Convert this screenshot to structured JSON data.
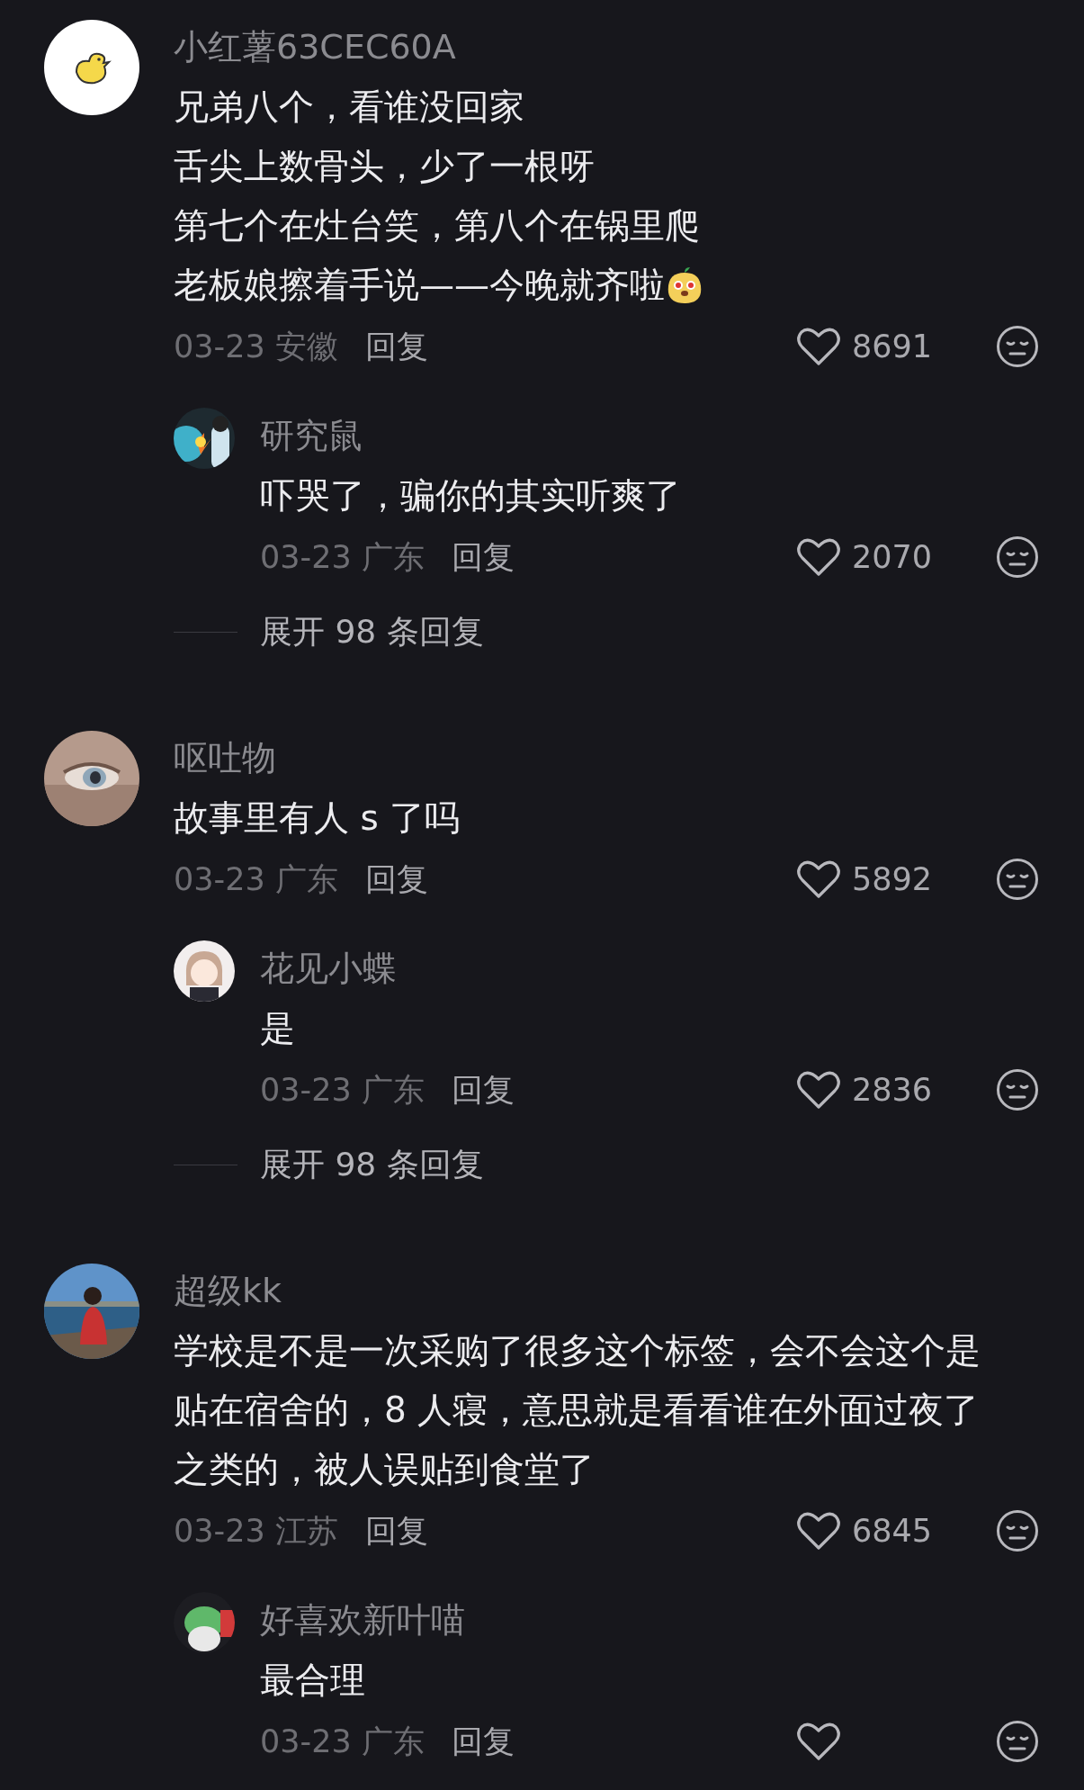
{
  "comments": [
    {
      "user": "小红薯63CEC60A",
      "lines": [
        "兄弟八个，看谁没回家",
        "舌尖上数骨头，少了一根呀",
        "第七个在灶台笑，第八个在锅里爬",
        "老板娘擦着手说——今晚就齐啦"
      ],
      "sticker": true,
      "date": "03-23 安徽",
      "reply_label": "回复",
      "likes": "8691",
      "replies": [
        {
          "user": "研究鼠",
          "lines": [
            "吓哭了，骗你的其实听爽了"
          ],
          "date": "03-23 广东",
          "reply_label": "回复",
          "likes": "2070"
        }
      ],
      "expand": "展开 98 条回复"
    },
    {
      "user": "呕吐物",
      "lines": [
        "故事里有人 s 了吗"
      ],
      "sticker": false,
      "date": "03-23 广东",
      "reply_label": "回复",
      "likes": "5892",
      "replies": [
        {
          "user": "花见小蝶",
          "lines": [
            "是"
          ],
          "date": "03-23 广东",
          "reply_label": "回复",
          "likes": "2836"
        }
      ],
      "expand": "展开 98 条回复"
    },
    {
      "user": "超级kk",
      "lines": [
        "学校是不是一次采购了很多这个标签，会不会这个是",
        "贴在宿舍的，8 人寝，意思就是看看谁在外面过夜了",
        "之类的，被人误贴到食堂了"
      ],
      "sticker": false,
      "date": "03-23 江苏",
      "reply_label": "回复",
      "likes": "6845",
      "replies": [
        {
          "user": "好喜欢新叶喵",
          "lines": [
            "最合理"
          ],
          "date": "03-23 广东",
          "reply_label": "回复"
        }
      ]
    }
  ]
}
